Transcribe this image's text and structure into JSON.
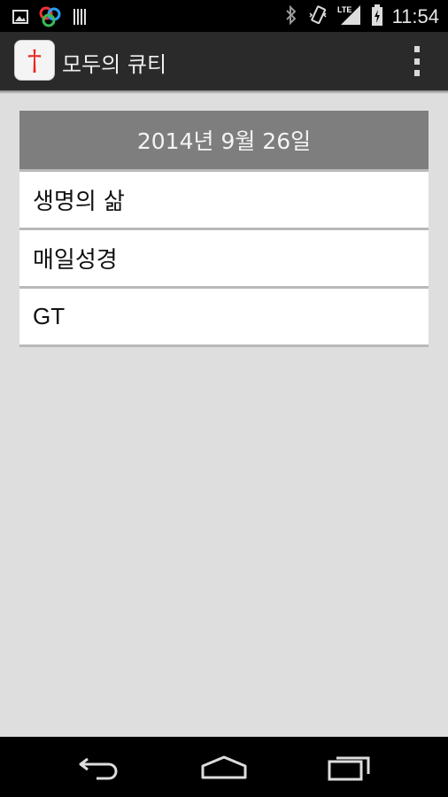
{
  "status_bar": {
    "time": "11:54",
    "left_icons": [
      "gallery-icon",
      "color-circles-icon",
      "barcode-icon"
    ],
    "right_icons": [
      "bluetooth-icon",
      "vibrate-icon",
      "lte-signal-icon",
      "battery-icon"
    ],
    "network_label": "LTE"
  },
  "action_bar": {
    "app_icon_glyph": "†",
    "title": "모두의 큐티",
    "overflow_icon": "overflow-menu-icon"
  },
  "card": {
    "date_header": "2014년 9월 26일",
    "items": [
      {
        "label": "생명의 삶"
      },
      {
        "label": "매일성경"
      },
      {
        "label": "GT"
      }
    ]
  },
  "nav_bar": {
    "buttons": [
      "back-icon",
      "home-icon",
      "recent-apps-icon"
    ]
  },
  "colors": {
    "status_bar": "#000000",
    "action_bar": "#2a2a2a",
    "card_header": "#7e7e7e",
    "background": "#dedede",
    "cross": "#e8271f"
  }
}
